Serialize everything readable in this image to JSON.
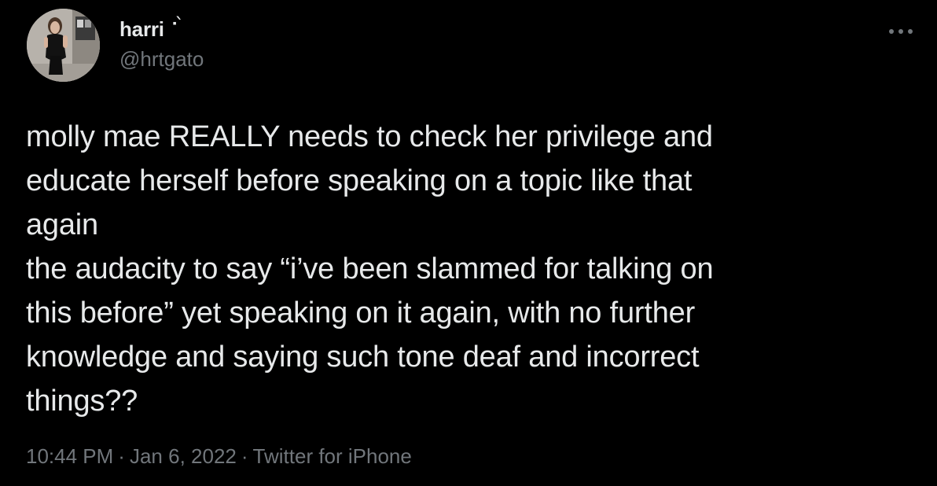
{
  "tweet": {
    "author": {
      "display_name": "harri",
      "name_emoji": "⠂̀",
      "handle": "@hrtgato",
      "avatar_icon": "profile-photo"
    },
    "more_icon": "more-options-icon",
    "text": "molly mae REALLY needs to check her privilege and\neducate herself before speaking on a topic like that\nagain\nthe audacity to say “i’ve been slammed for talking on\nthis before” yet speaking on it again, with no further\nknowledge and saying such tone deaf and incorrect\nthings??",
    "meta": {
      "time": "10:44 PM",
      "separator": "·",
      "date": "Jan 6, 2022",
      "source": "Twitter for iPhone"
    }
  },
  "colors": {
    "background": "#000000",
    "primary_text": "#e7e9ea",
    "secondary_text": "#71767b"
  }
}
